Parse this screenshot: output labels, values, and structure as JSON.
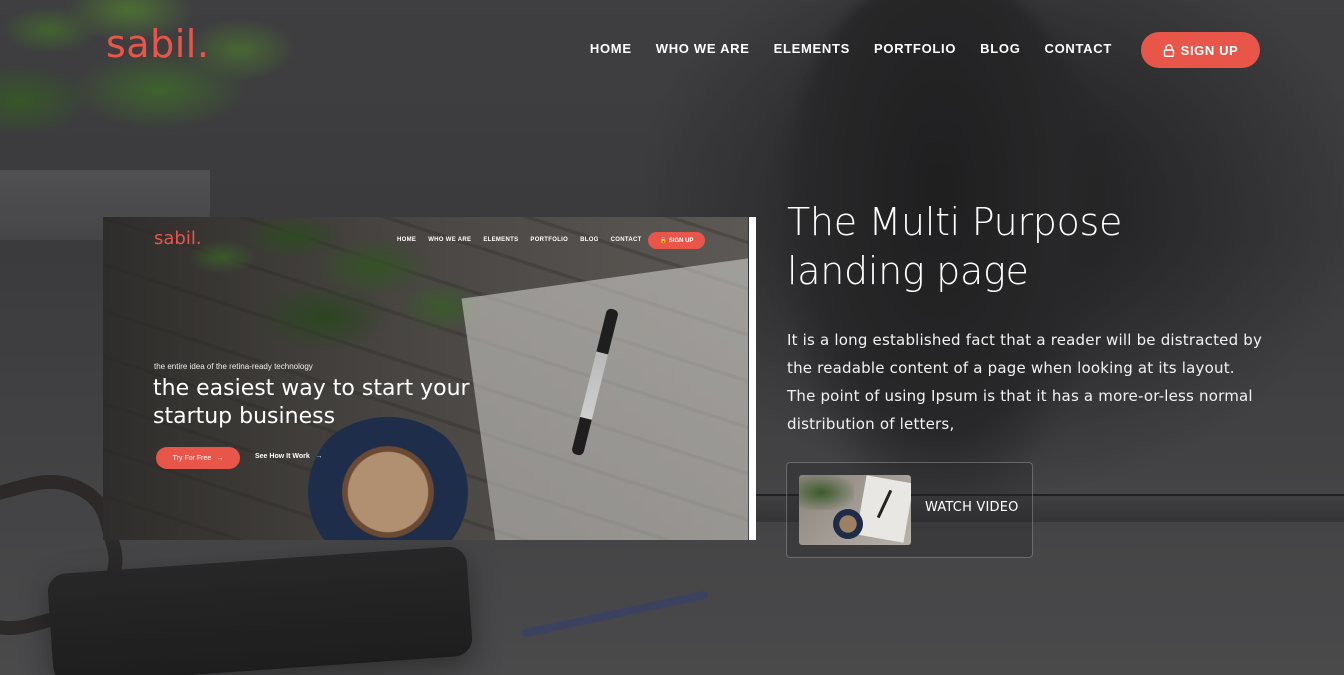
{
  "brand": {
    "logo": "sabil.",
    "accent_color": "#e8564a"
  },
  "nav": {
    "items": [
      {
        "label": "HOME"
      },
      {
        "label": "WHO WE ARE"
      },
      {
        "label": "ELEMENTS"
      },
      {
        "label": "PORTFOLIO"
      },
      {
        "label": "BLOG"
      },
      {
        "label": "CONTACT"
      }
    ],
    "signup": {
      "label": "SIGN UP",
      "icon": "lock-icon"
    }
  },
  "preview": {
    "logo": "sabil.",
    "nav": [
      "HOME",
      "WHO WE ARE",
      "ELEMENTS",
      "PORTFOLIO",
      "BLOG",
      "CONTACT"
    ],
    "signup": "🔒 SIGN UP",
    "tagline": "the entire idea of the retina-ready technology",
    "headline": "the easiest way to start your startup business",
    "try_button": "Try For Free",
    "see_link": "See How It Work"
  },
  "hero": {
    "title": "The Multi Purpose landing page",
    "description": "It is a long established fact that a reader will be distracted by the readable content of a page when looking at its layout. The point of using Ipsum is that it has a more-or-less normal distribution of letters,"
  },
  "watch_video": {
    "label": "WATCH VIDEO"
  }
}
